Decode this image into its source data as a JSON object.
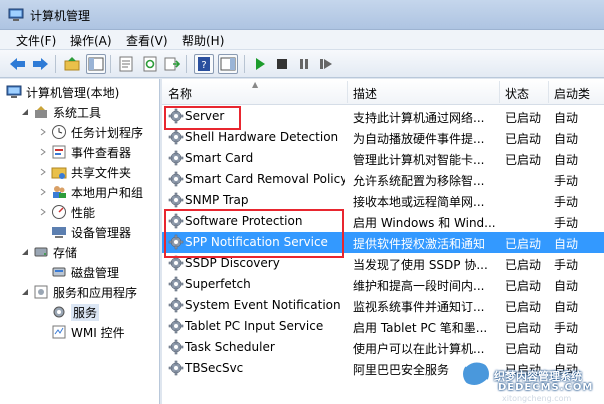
{
  "window": {
    "title": "计算机管理"
  },
  "menu": [
    {
      "id": "file",
      "label": "文件(F)"
    },
    {
      "id": "action",
      "label": "操作(A)"
    },
    {
      "id": "view",
      "label": "查看(V)"
    },
    {
      "id": "help",
      "label": "帮助(H)"
    }
  ],
  "toolbar": [
    {
      "name": "back-icon"
    },
    {
      "name": "forward-icon"
    },
    {
      "name": "up-folder-icon"
    },
    {
      "name": "show-tree-icon"
    },
    {
      "name": "properties-icon"
    },
    {
      "name": "refresh-icon"
    },
    {
      "name": "export-list-icon"
    },
    {
      "name": "help-icon"
    },
    {
      "name": "action-pane-icon"
    },
    {
      "name": "play-icon"
    },
    {
      "name": "stop-icon"
    },
    {
      "name": "pause-icon"
    },
    {
      "name": "restart-icon"
    }
  ],
  "tree": {
    "root": "计算机管理(本地)",
    "items": [
      {
        "label": "系统工具",
        "level": 1,
        "expander": "expanded",
        "icon": "tools-icon"
      },
      {
        "label": "任务计划程序",
        "level": 2,
        "expander": "collapsed",
        "icon": "clock-icon"
      },
      {
        "label": "事件查看器",
        "level": 2,
        "expander": "collapsed",
        "icon": "event-viewer-icon"
      },
      {
        "label": "共享文件夹",
        "level": 2,
        "expander": "collapsed",
        "icon": "shared-folder-icon"
      },
      {
        "label": "本地用户和组",
        "level": 2,
        "expander": "collapsed",
        "icon": "users-icon"
      },
      {
        "label": "性能",
        "level": 2,
        "expander": "collapsed",
        "icon": "performance-icon"
      },
      {
        "label": "设备管理器",
        "level": 2,
        "expander": "none",
        "icon": "device-manager-icon"
      },
      {
        "label": "存储",
        "level": 1,
        "expander": "expanded",
        "icon": "storage-icon"
      },
      {
        "label": "磁盘管理",
        "level": 2,
        "expander": "none",
        "icon": "disk-icon"
      },
      {
        "label": "服务和应用程序",
        "level": 1,
        "expander": "expanded",
        "icon": "services-apps-icon"
      },
      {
        "label": "服务",
        "level": 2,
        "expander": "none",
        "icon": "services-icon",
        "selected": true
      },
      {
        "label": "WMI 控件",
        "level": 2,
        "expander": "none",
        "icon": "wmi-icon"
      }
    ]
  },
  "list": {
    "columns": [
      "名称",
      "描述",
      "状态",
      "启动类"
    ],
    "rows": [
      {
        "name": "Server",
        "desc": "支持此计算机通过网络...",
        "status": "已启动",
        "start": "自动"
      },
      {
        "name": "Shell Hardware Detection",
        "desc": "为自动播放硬件事件提...",
        "status": "已启动",
        "start": "自动"
      },
      {
        "name": "Smart Card",
        "desc": "管理此计算机对智能卡...",
        "status": "已启动",
        "start": "自动"
      },
      {
        "name": "Smart Card Removal Policy",
        "desc": "允许系统配置为移除智...",
        "status": "",
        "start": "手动"
      },
      {
        "name": "SNMP Trap",
        "desc": "接收本地或远程简单网...",
        "status": "",
        "start": "手动"
      },
      {
        "name": "Software Protection",
        "desc": "启用 Windows 和 Wind...",
        "status": "",
        "start": "手动"
      },
      {
        "name": "SPP Notification Service",
        "desc": "提供软件授权激活和通知",
        "status": "已启动",
        "start": "自动",
        "selected": true
      },
      {
        "name": "SSDP Discovery",
        "desc": "当发现了使用 SSDP 协...",
        "status": "已启动",
        "start": "手动"
      },
      {
        "name": "Superfetch",
        "desc": "维护和提高一段时间内...",
        "status": "已启动",
        "start": "自动"
      },
      {
        "name": "System Event Notification ...",
        "desc": "监视系统事件并通知订...",
        "status": "已启动",
        "start": "自动"
      },
      {
        "name": "Tablet PC Input Service",
        "desc": "启用 Tablet PC 笔和墨...",
        "status": "已启动",
        "start": "手动"
      },
      {
        "name": "Task Scheduler",
        "desc": "使用户可以在此计算机...",
        "status": "已启动",
        "start": "自动"
      },
      {
        "name": "TBSecSvc",
        "desc": "阿里巴巴安全服务",
        "status": "已启动",
        "start": "自动"
      }
    ]
  },
  "watermark": {
    "text": "织梦内容管理系统",
    "site": "DEDECMS.COM",
    "brand": "xitongcheng.com"
  },
  "colors": {
    "selection": "#3399ff",
    "highlight_box": "#e8262f"
  }
}
